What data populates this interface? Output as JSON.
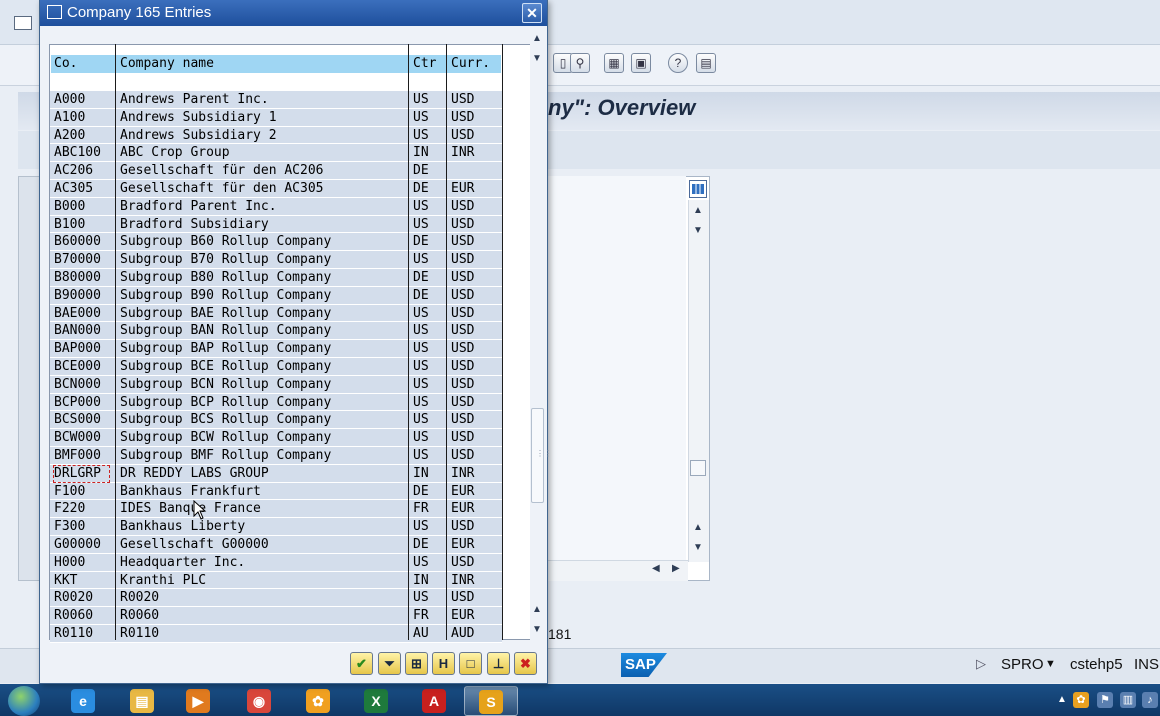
{
  "background": {
    "title": "ny\": Overview",
    "row_count": "181",
    "status": {
      "transaction": "SPRO",
      "server": "cstehp5",
      "mode": "INS"
    },
    "sap_logo": "SAP"
  },
  "dialog": {
    "title": "Company 165 Entries",
    "columns": [
      "Co.",
      "Company name",
      "Ctr",
      "Curr."
    ],
    "rows": [
      {
        "co": "A000",
        "name": "Andrews Parent Inc.",
        "ctr": "US",
        "curr": "USD"
      },
      {
        "co": "A100",
        "name": "Andrews Subsidiary 1",
        "ctr": "US",
        "curr": "USD"
      },
      {
        "co": "A200",
        "name": "Andrews Subsidiary 2",
        "ctr": "US",
        "curr": "USD"
      },
      {
        "co": "ABC100",
        "name": "ABC Crop Group",
        "ctr": "IN",
        "curr": "INR"
      },
      {
        "co": "AC206",
        "name": "Gesellschaft für den AC206",
        "ctr": "DE",
        "curr": ""
      },
      {
        "co": "AC305",
        "name": "Gesellschaft für den AC305",
        "ctr": "DE",
        "curr": "EUR"
      },
      {
        "co": "B000",
        "name": "Bradford Parent Inc.",
        "ctr": "US",
        "curr": "USD"
      },
      {
        "co": "B100",
        "name": "Bradford Subsidiary",
        "ctr": "US",
        "curr": "USD"
      },
      {
        "co": "B60000",
        "name": "Subgroup B60 Rollup Company",
        "ctr": "DE",
        "curr": "USD"
      },
      {
        "co": "B70000",
        "name": "Subgroup B70 Rollup Company",
        "ctr": "US",
        "curr": "USD"
      },
      {
        "co": "B80000",
        "name": "Subgroup B80 Rollup Company",
        "ctr": "DE",
        "curr": "USD"
      },
      {
        "co": "B90000",
        "name": "Subgroup B90 Rollup Company",
        "ctr": "DE",
        "curr": "USD"
      },
      {
        "co": "BAE000",
        "name": "Subgroup BAE Rollup Company",
        "ctr": "US",
        "curr": "USD"
      },
      {
        "co": "BAN000",
        "name": "Subgroup BAN Rollup Company",
        "ctr": "US",
        "curr": "USD"
      },
      {
        "co": "BAP000",
        "name": "Subgroup BAP Rollup Company",
        "ctr": "US",
        "curr": "USD"
      },
      {
        "co": "BCE000",
        "name": "Subgroup BCE Rollup Company",
        "ctr": "US",
        "curr": "USD"
      },
      {
        "co": "BCN000",
        "name": "Subgroup BCN Rollup Company",
        "ctr": "US",
        "curr": "USD"
      },
      {
        "co": "BCP000",
        "name": "Subgroup BCP Rollup Company",
        "ctr": "US",
        "curr": "USD"
      },
      {
        "co": "BCS000",
        "name": "Subgroup BCS Rollup Company",
        "ctr": "US",
        "curr": "USD"
      },
      {
        "co": "BCW000",
        "name": "Subgroup BCW Rollup Company",
        "ctr": "US",
        "curr": "USD"
      },
      {
        "co": "BMF000",
        "name": "Subgroup BMF Rollup Company",
        "ctr": "US",
        "curr": "USD"
      },
      {
        "co": "DRLGRP",
        "name": "DR REDDY LABS GROUP",
        "ctr": "IN",
        "curr": "INR"
      },
      {
        "co": "F100",
        "name": "Bankhaus Frankfurt",
        "ctr": "DE",
        "curr": "EUR"
      },
      {
        "co": "F220",
        "name": "IDES Banque France",
        "ctr": "FR",
        "curr": "EUR"
      },
      {
        "co": "F300",
        "name": "Bankhaus Liberty",
        "ctr": "US",
        "curr": "USD"
      },
      {
        "co": "G00000",
        "name": "Gesellschaft G00000",
        "ctr": "DE",
        "curr": "EUR"
      },
      {
        "co": "H000",
        "name": "Headquarter Inc.",
        "ctr": "US",
        "curr": "USD"
      },
      {
        "co": "KKT",
        "name": "Kranthi PLC",
        "ctr": "IN",
        "curr": "INR"
      },
      {
        "co": "R0020",
        "name": "R0020",
        "ctr": "US",
        "curr": "USD"
      },
      {
        "co": "R0060",
        "name": "R0060",
        "ctr": "FR",
        "curr": "EUR"
      },
      {
        "co": "R0110",
        "name": "R0110",
        "ctr": "AU",
        "curr": "AUD"
      }
    ],
    "buttons": [
      {
        "name": "continue-button",
        "glyph": "✔",
        "color": "#2a8a1e"
      },
      {
        "name": "restrictions-button",
        "glyph": "⏷",
        "color": "#1a2a40"
      },
      {
        "name": "new-selection-button",
        "glyph": "⊞",
        "color": "#1a2a40"
      },
      {
        "name": "save-button",
        "glyph": "H",
        "color": "#1a2a40"
      },
      {
        "name": "new-list-button",
        "glyph": "□",
        "color": "#1a2a40"
      },
      {
        "name": "pin-button",
        "glyph": "⊥",
        "color": "#1a2a40"
      },
      {
        "name": "cancel-button",
        "glyph": "✖",
        "color": "#cc1f1f"
      }
    ]
  },
  "taskbar": {
    "apps": [
      {
        "name": "internet-explorer",
        "glyph": "e",
        "color": "#2a8de0"
      },
      {
        "name": "file-explorer",
        "glyph": "▤",
        "color": "#e8b844"
      },
      {
        "name": "media-player",
        "glyph": "▶",
        "color": "#e07a1e"
      },
      {
        "name": "chrome",
        "glyph": "◉",
        "color": "#d9463b"
      },
      {
        "name": "flower-app",
        "glyph": "✿",
        "color": "#f0a020"
      },
      {
        "name": "excel",
        "glyph": "X",
        "color": "#1e7a3c"
      },
      {
        "name": "acrobat",
        "glyph": "A",
        "color": "#c8201e"
      },
      {
        "name": "sap-logon",
        "glyph": "S",
        "color": "#e6a21a"
      }
    ]
  }
}
